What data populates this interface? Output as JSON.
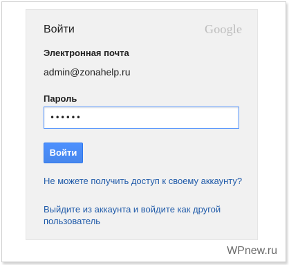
{
  "card": {
    "title": "Войти",
    "logo_text": "Google"
  },
  "email": {
    "label": "Электронная почта",
    "value": "admin@zonahelp.ru"
  },
  "password": {
    "label": "Пароль",
    "value": "••••••"
  },
  "signin_button": {
    "label": "Войти"
  },
  "links": {
    "cant_access": "Не можете получить доступ к своему аккаунту?",
    "switch_account": "Выйдите из аккаунта и войдите как другой пользователь"
  },
  "watermark": {
    "text": "WPnew.ru"
  },
  "colors": {
    "accent_blue": "#4d90fe",
    "link_blue": "#1f5aa9",
    "card_background": "#f1f1f1"
  }
}
